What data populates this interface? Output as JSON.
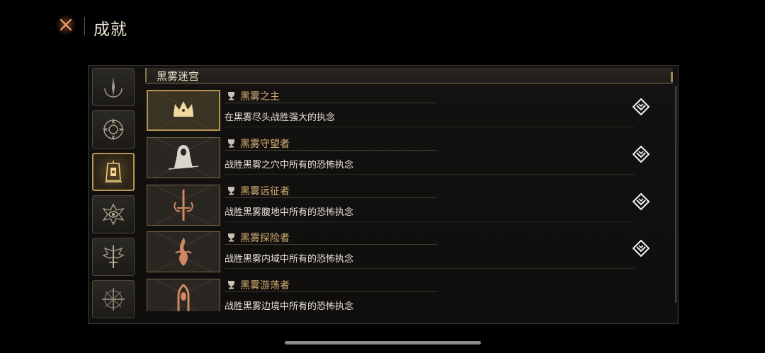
{
  "header": {
    "close_icon": "close-x-icon",
    "title": "成就"
  },
  "categories": [
    {
      "icon": "quill-moon-icon",
      "active": false
    },
    {
      "icon": "compass-target-icon",
      "active": false
    },
    {
      "icon": "lantern-gate-icon",
      "active": true
    },
    {
      "icon": "spiked-eye-icon",
      "active": false
    },
    {
      "icon": "winged-sword-icon",
      "active": false
    },
    {
      "icon": "spiked-cross-icon",
      "active": false
    }
  ],
  "section": {
    "title": "黑雾迷宫"
  },
  "achievements": [
    {
      "title": "黑雾之主",
      "description": "在黑雾尽头战胜强大的执念",
      "emblem": "crown-emblem-icon",
      "tier": "gold",
      "reward_icon": "reward-diamond-icon"
    },
    {
      "title": "黑雾守望者",
      "description": "战胜黑雾之穴中所有的恐怖执念",
      "emblem": "hooded-figure-emblem-icon",
      "tier": "silver",
      "reward_icon": "reward-diamond-icon"
    },
    {
      "title": "黑雾远征者",
      "description": "战胜黑雾腹地中所有的恐怖执念",
      "emblem": "sword-emblem-icon",
      "tier": "bronze",
      "reward_icon": "reward-diamond-icon"
    },
    {
      "title": "黑雾探险者",
      "description": "战胜黑雾内域中所有的恐怖执念",
      "emblem": "flame-emblem-icon",
      "tier": "bronze",
      "reward_icon": "reward-diamond-icon"
    },
    {
      "title": "黑雾游荡者",
      "description": "战胜黑雾边境中所有的恐怖执念",
      "emblem": "hand-emblem-icon",
      "tier": "bronze",
      "reward_icon": "reward-diamond-icon"
    }
  ],
  "colors": {
    "accent_gold": "#b8924f",
    "title_gold": "#d8b077",
    "close_orange": "#c4703a",
    "background": "#000000"
  }
}
